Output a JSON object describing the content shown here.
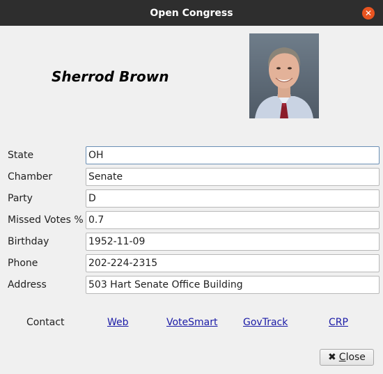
{
  "window": {
    "title": "Open Congress"
  },
  "profile": {
    "name": "Sherrod Brown"
  },
  "fields": [
    {
      "label": "State",
      "value": "OH"
    },
    {
      "label": "Chamber",
      "value": "Senate"
    },
    {
      "label": "Party",
      "value": "D"
    },
    {
      "label": "Missed Votes %",
      "value": "0.7"
    },
    {
      "label": "Birthday",
      "value": "1952-11-09"
    },
    {
      "label": "Phone",
      "value": "202-224-2315"
    },
    {
      "label": "Address",
      "value": "503 Hart Senate Office Building"
    }
  ],
  "contact": {
    "label": "Contact",
    "links": [
      "Web",
      "VoteSmart",
      "GovTrack",
      "CRP"
    ]
  },
  "buttons": {
    "close_mnemonic": "C",
    "close_rest": "lose"
  },
  "colors": {
    "titlebar": "#2e2e2e",
    "close_button": "#e95420",
    "link": "#1a1aa6"
  },
  "icons": {
    "window_close": "close-icon",
    "button_close": "x-icon"
  }
}
